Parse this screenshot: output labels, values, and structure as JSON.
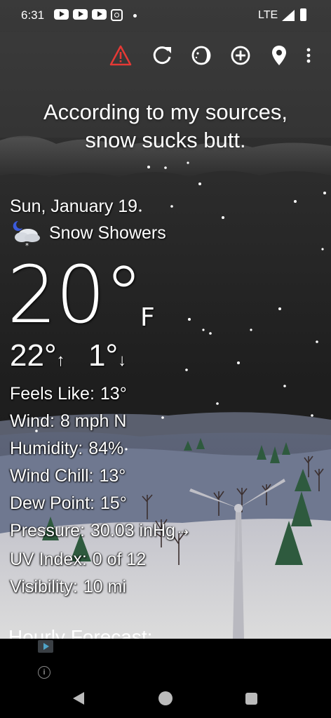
{
  "status_bar": {
    "time": "6:31",
    "network": "LTE",
    "notification_icons": [
      "youtube-icon",
      "youtube-icon",
      "youtube-icon",
      "instagram-icon",
      "dot-icon"
    ]
  },
  "toolbar": {
    "icons": [
      "alert-warning-icon",
      "refresh-icon",
      "moon-phase-icon",
      "add-location-icon",
      "location-pin-icon",
      "more-vert-icon"
    ]
  },
  "headline": {
    "line1": "According to my sources,",
    "line2": "snow sucks butt."
  },
  "current": {
    "date": "Sun, January 19",
    "condition": "Snow Showers",
    "condition_icon": "night-snow-showers-icon",
    "temperature": "20°",
    "unit": "F",
    "high": "22°",
    "high_arrow": "↑",
    "low": "1°",
    "low_arrow": "↓"
  },
  "details": {
    "feels_like_label": "Feels Like:",
    "feels_like": "13°",
    "wind_label": "Wind:",
    "wind": "8 mph N",
    "humidity_label": "Humidity:",
    "humidity": "84%",
    "wind_chill_label": "Wind Chill:",
    "wind_chill": "13°",
    "dew_point_label": "Dew Point:",
    "dew_point": "15°",
    "pressure_label": "Pressure:",
    "pressure": "30.03 inHg",
    "pressure_trend": "⇢",
    "uv_label": "UV Index:",
    "uv": "0 of 12",
    "visibility_label": "Visibility:",
    "visibility": "10 mi"
  },
  "hourly": {
    "heading": "Hourly Forecast:"
  },
  "colors": {
    "alert": "#e53935",
    "sky_top": "#2b2b2b",
    "sky_bottom": "#1c1c1c",
    "snow_ground": "#d9d9d9"
  }
}
